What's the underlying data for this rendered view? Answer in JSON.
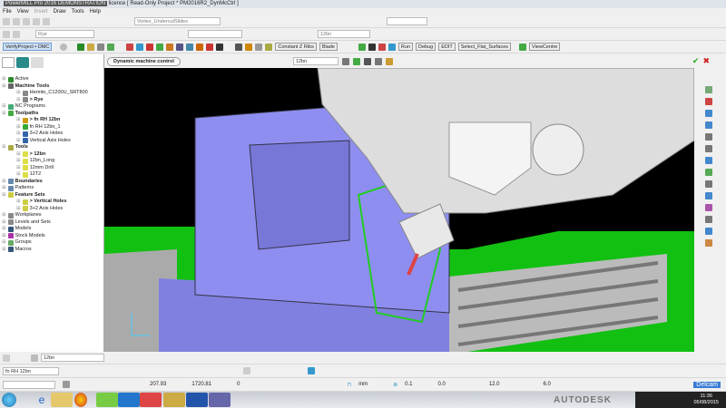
{
  "title": {
    "app": "PowerMILL Pro 2016 DEMONSTRATION",
    "rest": "licence  [ Read-Only Project * PM2016R2_DynMcCtrl ]"
  },
  "menu": [
    "File",
    "View",
    "Insert",
    "Draw",
    "Tools",
    "Help"
  ],
  "toolbar1": {
    "toolpath_select": "Vortex_UndercutSlides"
  },
  "toolbar2": {
    "model_select": "Rye",
    "tool_select": "12bn"
  },
  "toolbar3": {
    "verify_button": "VerifyProject • DMC",
    "constant_z_button": "Constant Z Ribs",
    "blade_button": "Blade",
    "run_button": "Run",
    "debug_button": "Debug",
    "edit_button": "EDIT",
    "flat_button": "Select_Flat_Surfaces",
    "viewcentre_button": "ViewCentre"
  },
  "dmc": {
    "tab": "Dynamic machine control",
    "tool_select": "12bn"
  },
  "tree": [
    {
      "label": "Active",
      "lvl": 0,
      "bold": false,
      "color": "#2a8a2a"
    },
    {
      "label": "Machine Tools",
      "lvl": 0,
      "bold": true,
      "color": "#666"
    },
    {
      "label": "Hermle_C1200U_SRT800",
      "lvl": 1,
      "bold": false,
      "color": "#888"
    },
    {
      "label": "> Rye",
      "lvl": 1,
      "bold": true,
      "color": "#888"
    },
    {
      "label": "NC Programs",
      "lvl": 0,
      "bold": false,
      "color": "#4a7"
    },
    {
      "label": "Toolpaths",
      "lvl": 0,
      "bold": true,
      "color": "#4a4"
    },
    {
      "label": "> fn RH 12bn",
      "lvl": 1,
      "bold": true,
      "color": "#c90"
    },
    {
      "label": "fn RH 12bn_1",
      "lvl": 1,
      "bold": false,
      "color": "#3a3"
    },
    {
      "label": "3+2 Axis Holes",
      "lvl": 1,
      "bold": false,
      "color": "#36a"
    },
    {
      "label": "Vertical Axis Holes",
      "lvl": 1,
      "bold": false,
      "color": "#36a"
    },
    {
      "label": "Tools",
      "lvl": 0,
      "bold": true,
      "color": "#aa4"
    },
    {
      "label": "> 12bn",
      "lvl": 1,
      "bold": true,
      "color": "#dd4"
    },
    {
      "label": "12bn_Long",
      "lvl": 1,
      "bold": false,
      "color": "#dd4"
    },
    {
      "label": "12mm Drill",
      "lvl": 1,
      "bold": false,
      "color": "#dd4"
    },
    {
      "label": "12T2",
      "lvl": 1,
      "bold": false,
      "color": "#dd4"
    },
    {
      "label": "Boundaries",
      "lvl": 0,
      "bold": true,
      "color": "#68a"
    },
    {
      "label": "Patterns",
      "lvl": 0,
      "bold": false,
      "color": "#68a"
    },
    {
      "label": "Feature Sets",
      "lvl": 0,
      "bold": true,
      "color": "#cc4"
    },
    {
      "label": "> Vertical Holes",
      "lvl": 1,
      "bold": true,
      "color": "#cc4"
    },
    {
      "label": "3+2 Axis Holes",
      "lvl": 1,
      "bold": false,
      "color": "#cc4"
    },
    {
      "label": "Workplanes",
      "lvl": 0,
      "bold": false,
      "color": "#888"
    },
    {
      "label": "Levels and Sets",
      "lvl": 0,
      "bold": false,
      "color": "#888"
    },
    {
      "label": "Models",
      "lvl": 0,
      "bold": false,
      "color": "#357"
    },
    {
      "label": "Stock Models",
      "lvl": 0,
      "bold": false,
      "color": "#a3a"
    },
    {
      "label": "Groups",
      "lvl": 0,
      "bold": false,
      "color": "#6a6"
    },
    {
      "label": "Macros",
      "lvl": 0,
      "bold": false,
      "color": "#357"
    }
  ],
  "bottom": {
    "tool_select": "12bn",
    "toolpath_select": "fn RH 12bn",
    "x": "207.93",
    "y": "1720.81",
    "z": "0",
    "units": "mm",
    "tol1": "0.1",
    "tol2": "0.0",
    "tol3": "12.0",
    "tol4": "6.0",
    "brand": "Delcam"
  },
  "taskbar": {
    "watermark": "AUTODESK",
    "time": "11:36",
    "date": "05/08/2015"
  }
}
